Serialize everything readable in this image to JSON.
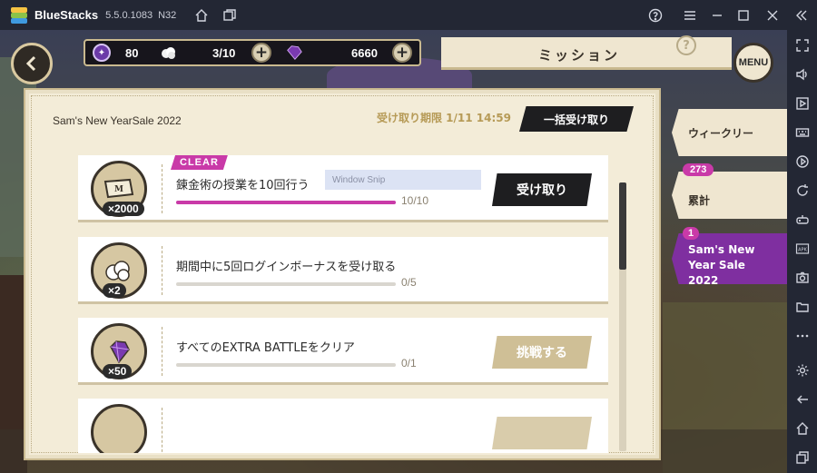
{
  "titlebar": {
    "app_name": "BlueStacks",
    "version": "5.5.0.1083",
    "build": "N32"
  },
  "header": {
    "currencies": [
      {
        "name": "orb",
        "value": "80"
      },
      {
        "name": "cotton",
        "value": "3/10"
      },
      {
        "name": "gem",
        "value": "6660"
      }
    ],
    "title": "ミッション",
    "help": "?",
    "menu_label": "MENU"
  },
  "panel": {
    "title": "Sam's New YearSale 2022",
    "deadline": "受け取り期限 1/11 14:59",
    "bulk_claim_label": "一括受け取り"
  },
  "missions": [
    {
      "reward_icon": "m-badge",
      "reward_count": "×2000",
      "text": "錬金術の授業を10回行う",
      "progress_text": "10/10",
      "progress": 1.0,
      "status": "CLEAR",
      "button_label": "受け取り",
      "tooltip": "Window Snip"
    },
    {
      "reward_icon": "cotton",
      "reward_count": "×2",
      "text": "期間中に5回ログインボーナスを受け取る",
      "progress_text": "0/5",
      "progress": 0.0
    },
    {
      "reward_icon": "gem",
      "reward_count": "×50",
      "text": "すべてのEXTRA BATTLEをクリア",
      "progress_text": "0/1",
      "progress": 0.0,
      "button_label": "挑戦する"
    }
  ],
  "tabs": [
    {
      "label": "ウィークリー",
      "count": ""
    },
    {
      "label": "累計",
      "count": "273"
    },
    {
      "label": "Sam's New Year Sale 2022",
      "count": "1"
    }
  ],
  "colors": {
    "accent": "#c93aa8",
    "panel_bg": "#f3ecd8",
    "button_dark": "#1e1e20",
    "button_gold": "#cfbf96",
    "titlebar_bg": "#232734"
  }
}
